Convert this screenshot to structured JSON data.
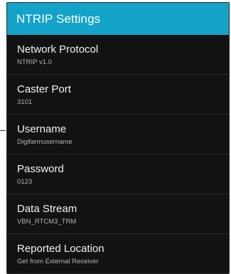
{
  "header": {
    "title": "NTRIP Settings"
  },
  "settings": [
    {
      "label": "Network Protocol",
      "value": "NTRIP v1.0"
    },
    {
      "label": "Caster Port",
      "value": "3101"
    },
    {
      "label": "Username",
      "value": "Digifarmusername"
    },
    {
      "label": "Password",
      "value": "0123"
    },
    {
      "label": "Data Stream",
      "value": "VBN_RTCM3_TRM"
    },
    {
      "label": "Reported Location",
      "value": "Get from External Receiver"
    }
  ],
  "colors": {
    "header_background": "#13a3c8",
    "screen_background": "#121212",
    "title_text": "#f2f2f2",
    "value_text": "#b3b3b3"
  }
}
